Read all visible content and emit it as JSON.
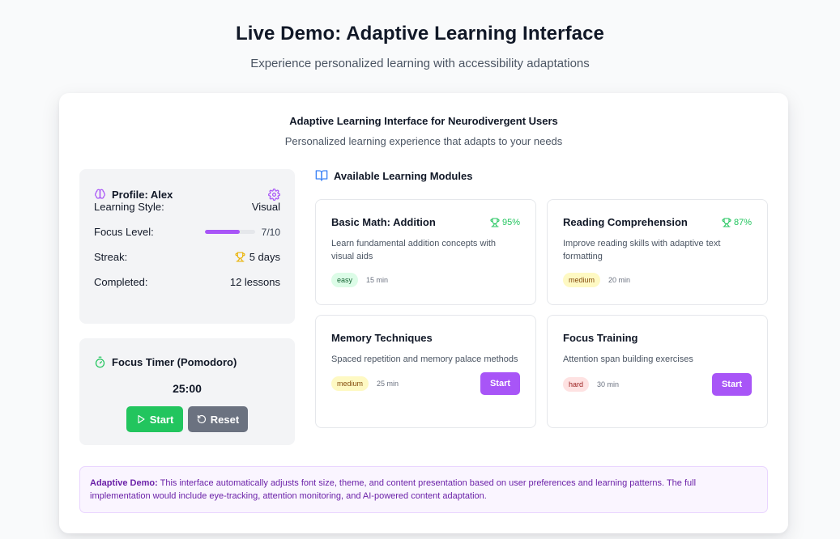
{
  "header": {
    "title": "Live Demo: Adaptive Learning Interface",
    "subtitle": "Experience personalized learning with accessibility adaptations"
  },
  "card": {
    "title": "Adaptive Learning Interface for Neurodivergent Users",
    "subtitle": "Personalized learning experience that adapts to your needs"
  },
  "profile": {
    "title": "Profile: Alex",
    "icon": "brain-icon",
    "settings_icon": "gear-icon",
    "rows": [
      {
        "label": "Learning Style:",
        "value": "Visual"
      },
      {
        "label": "Focus Level:",
        "value": "7/10",
        "level": 0.7
      },
      {
        "label": "Streak:",
        "value": "5 days",
        "icon": "trophy-icon"
      },
      {
        "label": "Completed:",
        "value": "12 lessons"
      }
    ]
  },
  "timer": {
    "title": "Focus Timer (Pomodoro)",
    "icon": "timer-icon",
    "time": "25:00",
    "start_label": "Start",
    "reset_label": "Reset"
  },
  "modules": {
    "heading": "Available Learning Modules",
    "icon": "book-open-icon",
    "items": [
      {
        "title": "Basic Math: Addition",
        "score": "95%",
        "desc": "Learn fundamental addition concepts with visual aids",
        "difficulty": "easy",
        "duration": "15 min"
      },
      {
        "title": "Reading Comprehension",
        "score": "87%",
        "desc": "Improve reading skills with adaptive text formatting",
        "difficulty": "medium",
        "duration": "20 min"
      },
      {
        "title": "Memory Techniques",
        "desc": "Spaced repetition and memory palace methods",
        "difficulty": "medium",
        "duration": "25 min",
        "action": "Start"
      },
      {
        "title": "Focus Training",
        "desc": "Attention span building exercises",
        "difficulty": "hard",
        "duration": "30 min",
        "action": "Start"
      }
    ]
  },
  "notice": {
    "label": "Adaptive Demo:",
    "text": " This interface automatically adjusts font size, theme, and content presentation based on user preferences and learning patterns. The full implementation would include eye-tracking, attention monitoring, and AI-powered content adaptation."
  },
  "colors": {
    "accent": "#a855f7",
    "success": "#22c55e",
    "neutral_button": "#6b7280",
    "trophy": "#eab308"
  }
}
